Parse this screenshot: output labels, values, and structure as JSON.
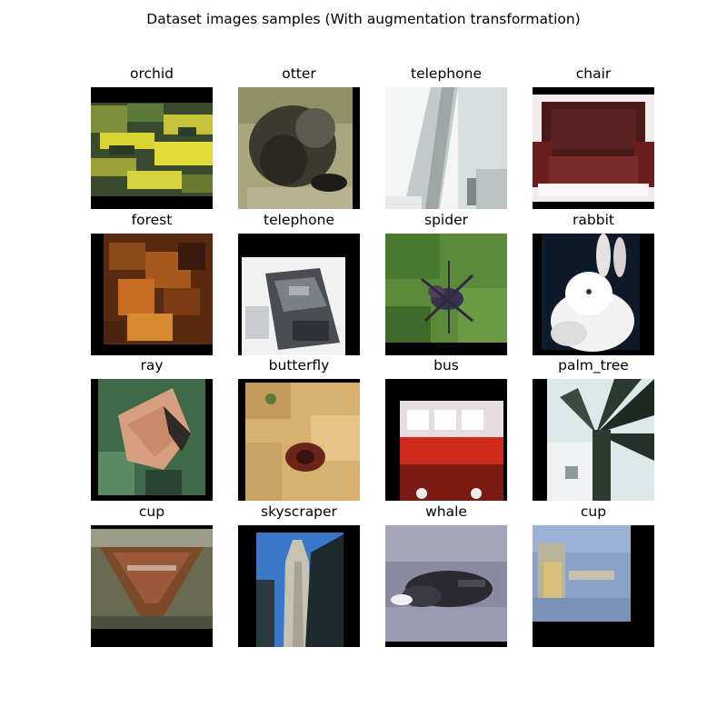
{
  "figure": {
    "suptitle": "Dataset images samples (With augmentation transformation)"
  },
  "samples": [
    {
      "label": "orchid"
    },
    {
      "label": "otter"
    },
    {
      "label": "telephone"
    },
    {
      "label": "chair"
    },
    {
      "label": "forest"
    },
    {
      "label": "telephone"
    },
    {
      "label": "spider"
    },
    {
      "label": "rabbit"
    },
    {
      "label": "ray"
    },
    {
      "label": "butterfly"
    },
    {
      "label": "bus"
    },
    {
      "label": "palm_tree"
    },
    {
      "label": "cup"
    },
    {
      "label": "skyscraper"
    },
    {
      "label": "whale"
    },
    {
      "label": "cup"
    }
  ]
}
